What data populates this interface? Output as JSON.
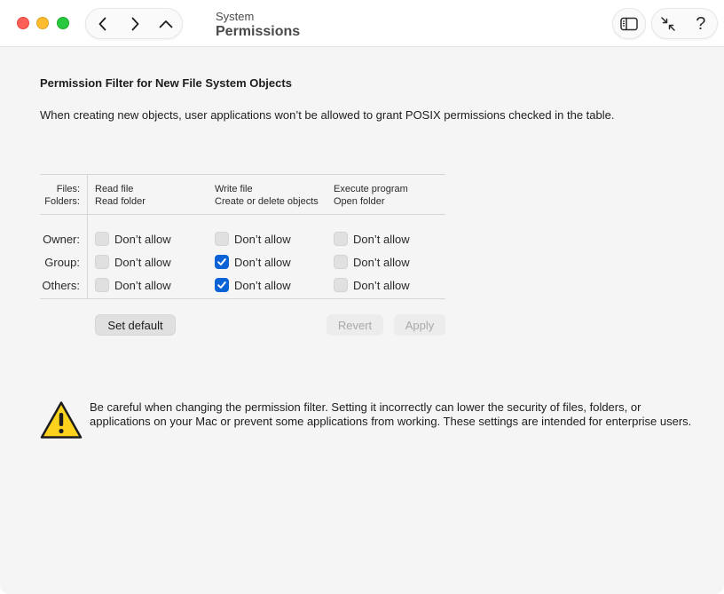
{
  "window": {
    "title_sub": "System",
    "title_main": "Permissions"
  },
  "toolbar": {
    "back_icon": "chevron-left-icon",
    "forward_icon": "chevron-right-icon",
    "up_icon": "chevron-up-icon",
    "sidebar_icon": "sidebar-icon",
    "collapse_icon": "collapse-arrows-icon",
    "help_label": "?"
  },
  "main": {
    "heading": "Permission Filter for New File System Objects",
    "description": "When creating new objects, user applications won’t be allowed to grant POSIX permissions checked in the table."
  },
  "table": {
    "header_files_label": "Files:",
    "header_folders_label": "Folders:",
    "columns": [
      {
        "file": "Read file",
        "folder": "Read folder"
      },
      {
        "file": "Write file",
        "folder": "Create or delete objects"
      },
      {
        "file": "Execute program",
        "folder": "Open folder"
      }
    ],
    "rows": [
      {
        "label": "Owner:",
        "cells": [
          {
            "text": "Don’t allow",
            "checked": false
          },
          {
            "text": "Don’t allow",
            "checked": false
          },
          {
            "text": "Don’t allow",
            "checked": false
          }
        ]
      },
      {
        "label": "Group:",
        "cells": [
          {
            "text": "Don’t allow",
            "checked": false
          },
          {
            "text": "Don’t allow",
            "checked": true
          },
          {
            "text": "Don’t allow",
            "checked": false
          }
        ]
      },
      {
        "label": "Others:",
        "cells": [
          {
            "text": "Don’t allow",
            "checked": false
          },
          {
            "text": "Don’t allow",
            "checked": true
          },
          {
            "text": "Don’t allow",
            "checked": false
          }
        ]
      }
    ]
  },
  "buttons": {
    "set_default": "Set default",
    "revert": "Revert",
    "apply": "Apply"
  },
  "warning": {
    "icon": "warning-triangle-icon",
    "text": "Be careful when changing the permission filter. Setting it incorrectly can lower the security of files, folders, or applications on your Mac or prevent some applications from working. These settings are intended for enterprise users."
  },
  "colors": {
    "accent": "#0a63d6",
    "warning_yellow": "#fcd21d",
    "close": "#fe5f57",
    "minimize": "#febc2e",
    "maximize": "#28c840"
  }
}
